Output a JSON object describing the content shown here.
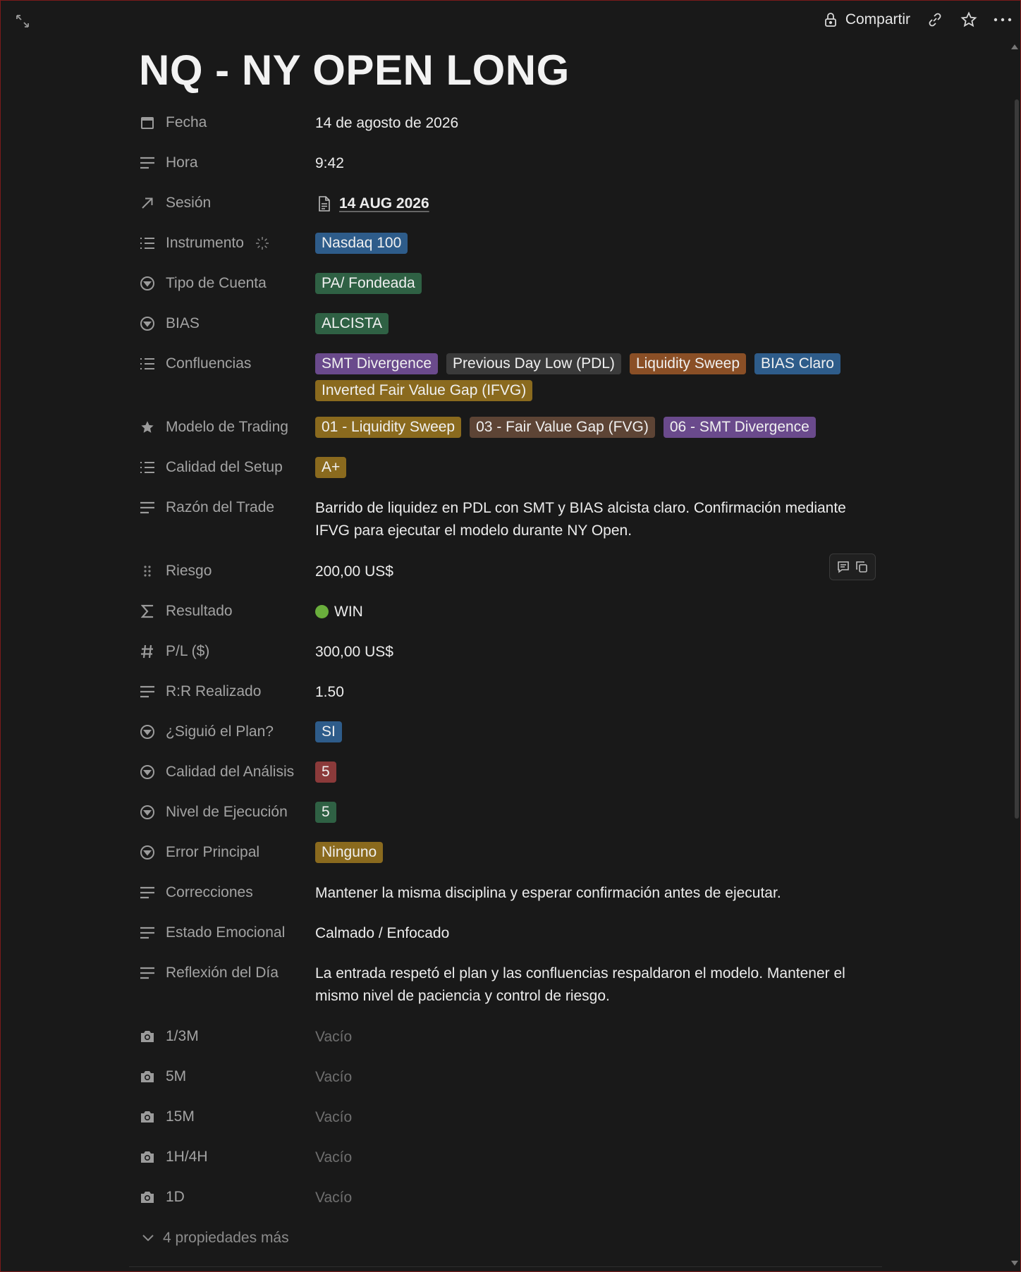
{
  "topbar": {
    "share_label": "Compartir",
    "icons": [
      "expand-icon",
      "lock-icon",
      "link-icon",
      "star-icon",
      "more-icon"
    ]
  },
  "page": {
    "title": "NQ - NY OPEN LONG"
  },
  "properties": {
    "fecha": {
      "label": "Fecha",
      "value": "14 de agosto de 2026"
    },
    "hora": {
      "label": "Hora",
      "value": "9:42"
    },
    "sesion": {
      "label": "Sesión",
      "value": "14 AUG 2026"
    },
    "instrumento": {
      "label": "Instrumento",
      "tags": [
        {
          "text": "Nasdaq 100",
          "color": "#2e5c8a"
        }
      ]
    },
    "tipo_cuenta": {
      "label": "Tipo de Cuenta",
      "tags": [
        {
          "text": "PA/ Fondeada",
          "color": "#2f6144"
        }
      ]
    },
    "bias": {
      "label": "BIAS",
      "tags": [
        {
          "text": "ALCISTA",
          "color": "#2f6144"
        }
      ]
    },
    "confluencias": {
      "label": "Confluencias",
      "tags": [
        {
          "text": "SMT Divergence",
          "color": "#6a4a8c"
        },
        {
          "text": "Previous Day Low (PDL)",
          "color": "#3a3a3a"
        },
        {
          "text": "Liquidity Sweep",
          "color": "#8a4f26"
        },
        {
          "text": "BIAS Claro",
          "color": "#2e5c8a"
        },
        {
          "text": "Inverted Fair Value Gap (IFVG)",
          "color": "#8a6a1e"
        }
      ]
    },
    "modelo": {
      "label": "Modelo de Trading",
      "tags": [
        {
          "text": "01 - Liquidity Sweep",
          "color": "#8a6a1e"
        },
        {
          "text": "03 - Fair Value Gap (FVG)",
          "color": "#5d4435"
        },
        {
          "text": "06 - SMT Divergence",
          "color": "#6a4a8c"
        }
      ]
    },
    "calidad_setup": {
      "label": "Calidad del Setup",
      "tags": [
        {
          "text": "A+",
          "color": "#8a6a1e"
        }
      ]
    },
    "razon": {
      "label": "Razón del Trade",
      "value": "Barrido de liquidez en PDL con SMT y BIAS alcista claro. Confirmación mediante IFVG para ejecutar el modelo durante NY Open."
    },
    "riesgo": {
      "label": "Riesgo",
      "value": "200,00 US$"
    },
    "resultado": {
      "label": "Resultado",
      "value": "WIN",
      "status_color": "#6aae3c"
    },
    "pl": {
      "label": "P/L ($)",
      "value": "300,00 US$"
    },
    "rr": {
      "label": "R:R Realizado",
      "value": "1.50"
    },
    "siguio_plan": {
      "label": "¿Siguió el Plan?",
      "tags": [
        {
          "text": "SI",
          "color": "#2e5c8a"
        }
      ]
    },
    "calidad_analisis": {
      "label": "Calidad del Análisis",
      "tags": [
        {
          "text": "5",
          "color": "#8b3a3a"
        }
      ]
    },
    "nivel_ejecucion": {
      "label": "Nivel de Ejecución",
      "tags": [
        {
          "text": "5",
          "color": "#2f6144"
        }
      ]
    },
    "error_principal": {
      "label": "Error Principal",
      "tags": [
        {
          "text": "Ninguno",
          "color": "#8a6a1e"
        }
      ]
    },
    "correcciones": {
      "label": "Correcciones",
      "value": "Mantener la misma disciplina y esperar confirmación antes de ejecutar."
    },
    "estado_emocional": {
      "label": "Estado Emocional",
      "value": "Calmado / Enfocado"
    },
    "reflexion": {
      "label": "Reflexión del Día",
      "value": "La entrada respetó el plan y las confluencias respaldaron el modelo. Mantener el mismo nivel de paciencia y control de riesgo."
    },
    "tf_1_3m": {
      "label": "1/3M",
      "value": "Vacío"
    },
    "tf_5m": {
      "label": "5M",
      "value": "Vacío"
    },
    "tf_15m": {
      "label": "15M",
      "value": "Vacío"
    },
    "tf_1h4h": {
      "label": "1H/4H",
      "value": "Vacío"
    },
    "tf_1d": {
      "label": "1D",
      "value": "Vacío"
    }
  },
  "more_properties": "4 propiedades más"
}
